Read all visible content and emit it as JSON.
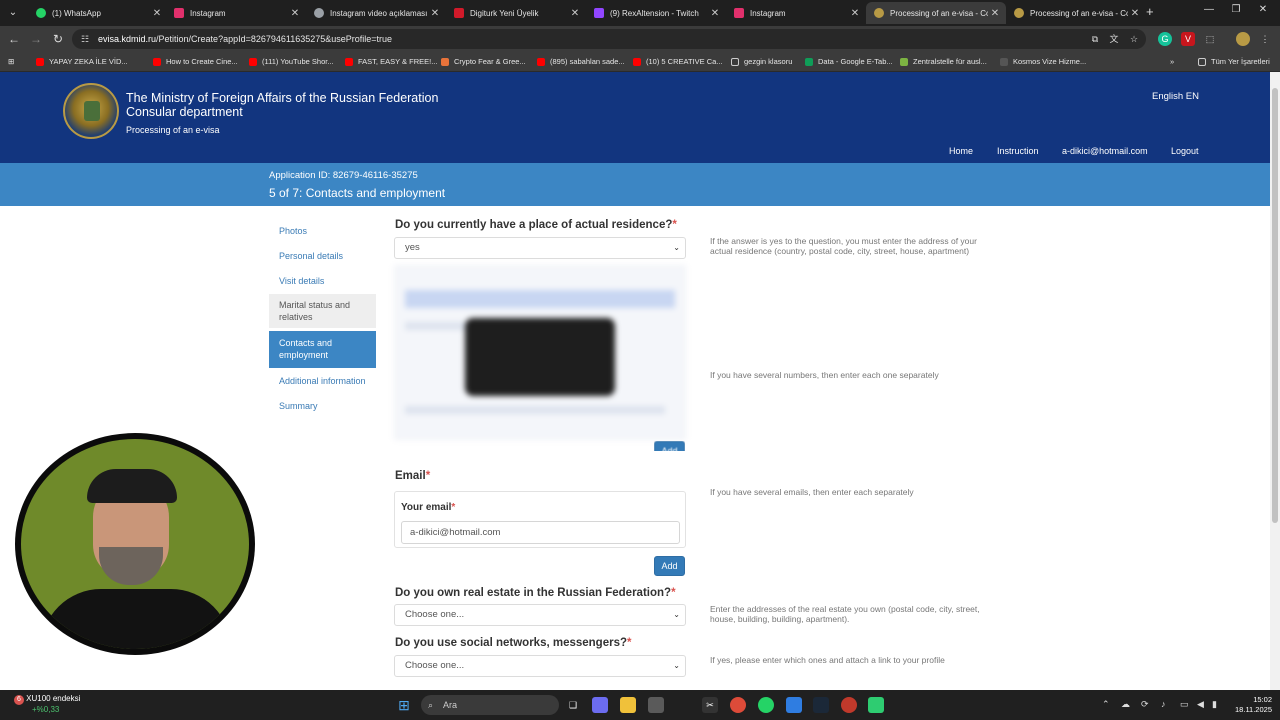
{
  "browser": {
    "tabs": [
      {
        "label": "(1) WhatsApp",
        "color": "#25d366"
      },
      {
        "label": "Instagram",
        "color": "#e1306c"
      },
      {
        "label": "Instagram video açıklaması",
        "color": "#9aa0a6"
      },
      {
        "label": "Digiturk Yeni Üyelik",
        "color": "#d11a2a"
      },
      {
        "label": "(9) RexAltension - Twitch",
        "color": "#9146ff"
      },
      {
        "label": "Instagram",
        "color": "#e1306c"
      },
      {
        "label": "Processing of an e-visa - Co",
        "color": "#b89a45"
      },
      {
        "label": "Processing of an e-visa - Co",
        "color": "#b89a45"
      }
    ],
    "url_host": "evisa.kdmid.ru",
    "url_path": "/Petition/Create?appId=826794611635275&useProfile=true",
    "bookmarks": [
      {
        "label": "YAPAY ZEKA İLE VİD...",
        "color": "#ff0000"
      },
      {
        "label": "How to Create Cine...",
        "color": "#ff0000"
      },
      {
        "label": "(111) YouTube Shor...",
        "color": "#ff0000"
      },
      {
        "label": "FAST, EASY & FREE!...",
        "color": "#ff0000"
      },
      {
        "label": "Crypto Fear & Gree...",
        "color": "#e8733a"
      },
      {
        "label": "(895) sabahlan sade...",
        "color": "#ff0000"
      },
      {
        "label": "(10) 5 CREATIVE Ca...",
        "color": "#ff0000"
      },
      {
        "label": "gezgin klasoru",
        "color": "#9aa0a6"
      },
      {
        "label": "Data - Google E-Tab...",
        "color": "#0f9d58"
      },
      {
        "label": "Zentralstelle für ausl...",
        "color": "#7cb342"
      },
      {
        "label": "Kosmos Vize Hizme...",
        "color": "#9aa0a6"
      },
      {
        "label": "Tüm Yer İşaretleri",
        "color": "#9aa0a6"
      }
    ]
  },
  "header": {
    "title_line1": "The Ministry of Foreign Affairs of the Russian Federation",
    "title_line2": "Consular department",
    "subtitle": "Processing of an e-visa",
    "language": "English  EN",
    "nav": [
      "Home",
      "Instruction",
      "a-dikici@hotmail.com",
      "Logout"
    ]
  },
  "app_bar": {
    "application_id": "Application ID: 82679-46116-35275",
    "step": "5 of 7: Contacts and employment"
  },
  "sidenav": {
    "items": [
      "Photos",
      "Personal details",
      "Visit details",
      "Marital status and relatives",
      "Contacts and employment",
      "Additional information",
      "Summary"
    ],
    "active_index": 4,
    "hover_index": 3
  },
  "form": {
    "residence": {
      "question": "Do you currently have a place of actual residence?",
      "value": "yes",
      "hint": "If the answer is yes to the question, you must enter the address of your actual residence (country, postal code, city, street, house, apartment)"
    },
    "phones": {
      "hint": "If you have several numbers, then enter each one separately",
      "add_label": "Add"
    },
    "email": {
      "section_label": "Email",
      "field_label": "Your email",
      "value": "a-dikici@hotmail.com",
      "hint": "If you have several emails, then enter each separately",
      "add_label": "Add"
    },
    "real_estate": {
      "question": "Do you own real estate in the Russian Federation?",
      "value": "Choose one...",
      "hint": "Enter the addresses of the real estate you own (postal code, city, street, house, building, building, apartment)."
    },
    "social": {
      "question": "Do you use social networks, messengers?",
      "value": "Choose one...",
      "hint": "If yes, please enter which ones and attach a link to your profile"
    },
    "required_mark": "*"
  },
  "taskbar": {
    "stock_name": "XU100 endeksi",
    "stock_change": "+%0,33",
    "stock_badge": "6",
    "search_placeholder": "Ara",
    "time": "15:02",
    "date": "18.11.2025"
  }
}
